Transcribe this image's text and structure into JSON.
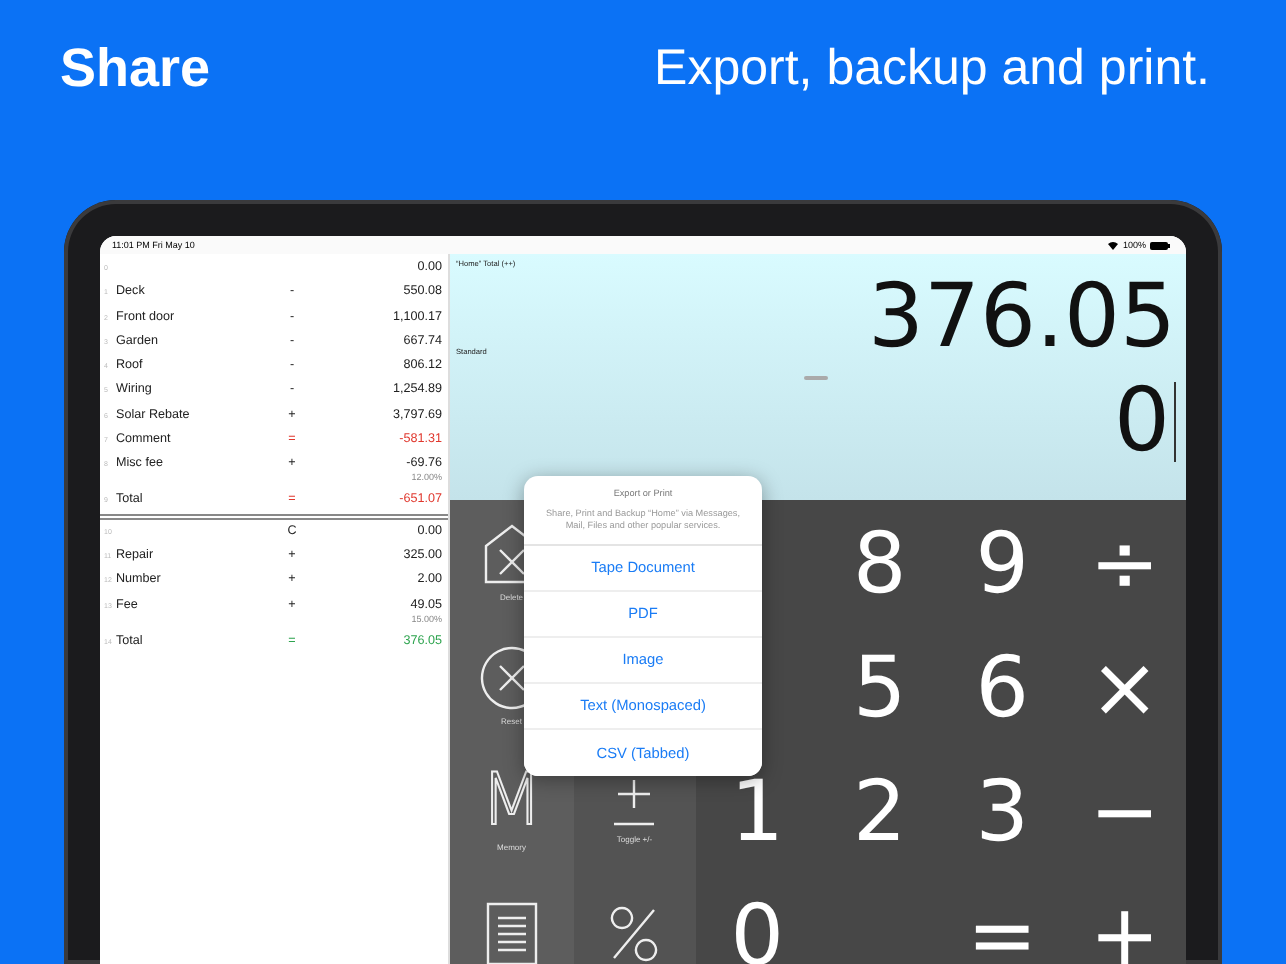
{
  "header": {
    "title": "Share",
    "tagline": "Export, backup and print."
  },
  "status_bar": {
    "time": "11:01 PM  Fri May 10",
    "battery": "100%"
  },
  "tape": [
    {
      "index": "0",
      "value": "0.00",
      "kind": "plain",
      "divider_after": false
    },
    {
      "index": "1",
      "name": "Deck",
      "operator": "-",
      "value": "550.08",
      "kind": "plain",
      "divider_after": false
    },
    {
      "index": "2",
      "name": "Front door",
      "operator": "-",
      "value": "1,100.17",
      "kind": "plain",
      "divider_after": false
    },
    {
      "index": "3",
      "name": "Garden",
      "operator": "-",
      "value": "667.74",
      "kind": "plain",
      "divider_after": false
    },
    {
      "index": "4",
      "name": "Roof",
      "operator": "-",
      "value": "806.12",
      "kind": "plain",
      "divider_after": false
    },
    {
      "index": "5",
      "name": "Wiring",
      "operator": "-",
      "value": "1,254.89",
      "kind": "plain",
      "divider_after": false
    },
    {
      "index": "6",
      "name": "Solar Rebate",
      "operator": "+",
      "value": "3,797.69",
      "kind": "plain",
      "divider_after": false
    },
    {
      "index": "7",
      "name": "Comment",
      "operator": "=",
      "value": "-581.31",
      "kind": "negative",
      "divider_after": false
    },
    {
      "index": "8",
      "name": "Misc fee",
      "operator": "+",
      "value": "-69.76",
      "note": "12.00%",
      "kind": "plain",
      "divider_after": false
    },
    {
      "index": "9",
      "name": "Total",
      "operator": "=",
      "value": "-651.07",
      "kind": "negative",
      "divider_after": true
    },
    {
      "index": "10",
      "operator": "C",
      "value": "0.00",
      "kind": "plain",
      "divider_after": false
    },
    {
      "index": "11",
      "name": "Repair",
      "operator": "+",
      "value": "325.00",
      "kind": "plain",
      "divider_after": false
    },
    {
      "index": "12",
      "name": "Number",
      "operator": "+",
      "value": "2.00",
      "kind": "plain",
      "divider_after": false
    },
    {
      "index": "13",
      "name": "Fee",
      "operator": "+",
      "value": "49.05",
      "note": "15.00%",
      "kind": "plain",
      "divider_after": false
    },
    {
      "index": "14",
      "name": "Total",
      "operator": "=",
      "value": "376.05",
      "kind": "positive",
      "divider_after": false
    }
  ],
  "display": {
    "tape_title": "“Home” Total (++)",
    "mode": "Standard",
    "result": "376.05",
    "entry": "0"
  },
  "function_keys": [
    {
      "kind": "delete",
      "label": "Delete"
    },
    {
      "kind": "blank"
    },
    {
      "kind": "reset",
      "label": "Reset"
    },
    {
      "kind": "blank"
    },
    {
      "kind": "memory",
      "glyph": "M",
      "label": "Memory"
    },
    {
      "kind": "toggle",
      "label": "Toggle +/-"
    },
    {
      "kind": "tape"
    },
    {
      "kind": "percent"
    }
  ],
  "number_keys": [
    {
      "kind": "blank"
    },
    {
      "kind": "key",
      "label": "8"
    },
    {
      "kind": "key",
      "label": "9"
    },
    {
      "kind": "key",
      "label": "÷"
    },
    {
      "kind": "blank"
    },
    {
      "kind": "key",
      "label": "5"
    },
    {
      "kind": "key",
      "label": "6"
    },
    {
      "kind": "key",
      "label": "×"
    },
    {
      "kind": "key",
      "label": "1"
    },
    {
      "kind": "key",
      "label": "2"
    },
    {
      "kind": "key",
      "label": "3"
    },
    {
      "kind": "key",
      "label": "−"
    },
    {
      "kind": "key",
      "label": "0"
    },
    {
      "kind": "blank"
    },
    {
      "kind": "key",
      "label": "="
    },
    {
      "kind": "key",
      "label": "+"
    }
  ],
  "export_menu": {
    "title": "Export or Print",
    "message": "Share, Print and Backup “Home” via Messages, Mail, Files and other popular services.",
    "options": [
      "Tape Document",
      "PDF",
      "Image",
      "Text (Monospaced)",
      "CSV (Tabbed)"
    ]
  }
}
